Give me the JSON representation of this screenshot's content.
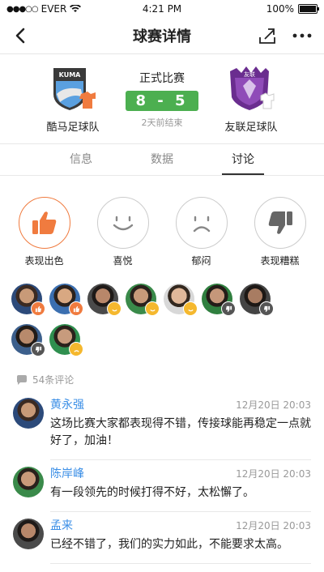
{
  "status": {
    "carrier": "EVER",
    "time": "4:21 PM",
    "battery": "100%"
  },
  "nav": {
    "title": "球赛详情",
    "back_icon": "back-chevron-icon",
    "share_icon": "share-icon",
    "more_icon": "more-dots-icon"
  },
  "match": {
    "home": {
      "name": "酷马足球队",
      "logo_text": "KUMA"
    },
    "away": {
      "name": "友联足球队",
      "logo_text": "友联"
    },
    "type": "正式比赛",
    "score": "8 - 5",
    "time_ago": "2天前结束"
  },
  "tabs": [
    {
      "label": "信息"
    },
    {
      "label": "数据"
    },
    {
      "label": "讨论"
    }
  ],
  "active_tab": "讨论",
  "reactions": [
    {
      "label": "表现出色",
      "icon": "thumbs-up-icon"
    },
    {
      "label": "喜悦",
      "icon": "smile-icon"
    },
    {
      "label": "郁闷",
      "icon": "frown-icon"
    },
    {
      "label": "表现糟糕",
      "icon": "thumbs-down-icon"
    }
  ],
  "comment_count": "54条评论",
  "comments": [
    {
      "author": "黄永强",
      "time": "12月20日 20:03",
      "text": "这场比赛大家都表现得不错，传接球能再稳定一点就好了，加油！"
    },
    {
      "author": "陈岸峰",
      "time": "12月20日 20:03",
      "text": "有一段领先的时候打得不好，太松懈了。"
    },
    {
      "author": "孟来",
      "time": "12月20日 20:03",
      "text": "已经不错了，我们的实力如此，不能要求太高。"
    }
  ],
  "colors": {
    "accent": "#f07b3f",
    "score_bg": "#4caf50",
    "link": "#3a8ee6",
    "smile_badge": "#f5b82e",
    "thumbs_badge": "#f07b3f",
    "down_badge": "#555555"
  }
}
